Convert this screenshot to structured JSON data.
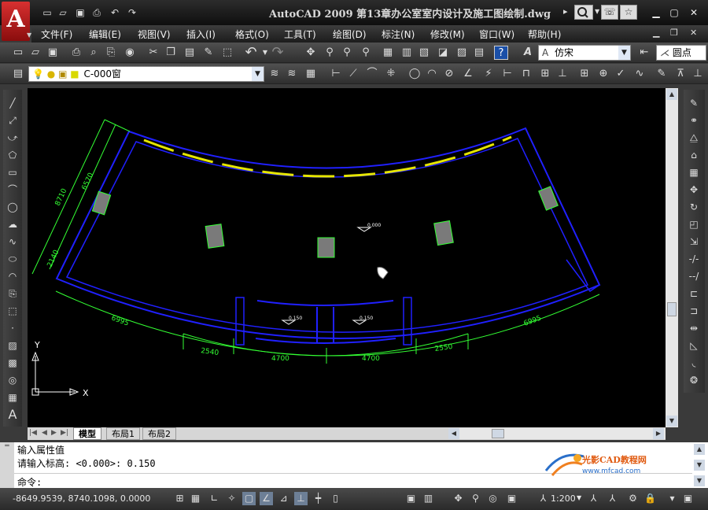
{
  "app": {
    "title": "AutoCAD 2009  第13章办公室室内设计及施工图绘制.dwg",
    "logo_letter": "A"
  },
  "quick_access": [
    "new-icon",
    "open-icon",
    "save-icon",
    "print-icon",
    "undo-icon",
    "redo-icon"
  ],
  "title_controls": {
    "play": "▸",
    "search": "search-icon",
    "help": "help-icon",
    "star": "star-icon"
  },
  "menu": [
    "文件(F)",
    "编辑(E)",
    "视图(V)",
    "插入(I)",
    "格式(O)",
    "工具(T)",
    "绘图(D)",
    "标注(N)",
    "修改(M)",
    "窗口(W)",
    "帮助(H)"
  ],
  "toolbar": {
    "text_style": "仿宋",
    "text_style_prefix": "A",
    "dim_style": "圆点",
    "layer": "C-000窗"
  },
  "drawing": {
    "dimensions": {
      "left_outer": "8710",
      "left_inner": "6570",
      "left_lower": "2140",
      "bottom_left": "6995",
      "bottom_right": "6995",
      "bottom_seg1": "2540",
      "bottom_seg2": "4700",
      "bottom_seg3": "4700",
      "bottom_seg4": "2550"
    },
    "levels": [
      "0.000",
      "0.150",
      "0.150"
    ],
    "ucs": {
      "x": "X",
      "y": "Y"
    }
  },
  "layout_tabs": [
    "模型",
    "布局1",
    "布局2"
  ],
  "command": {
    "line1": "输入属性值",
    "line2": "请输入标高: <0.000>: 0.150",
    "prompt": "命令:"
  },
  "watermark": {
    "name": "光影CAD教程网",
    "url": "www.mfcad.com"
  },
  "status": {
    "coords": "-8649.9539, 8740.1098, 0.0000",
    "scale": "1:200"
  }
}
